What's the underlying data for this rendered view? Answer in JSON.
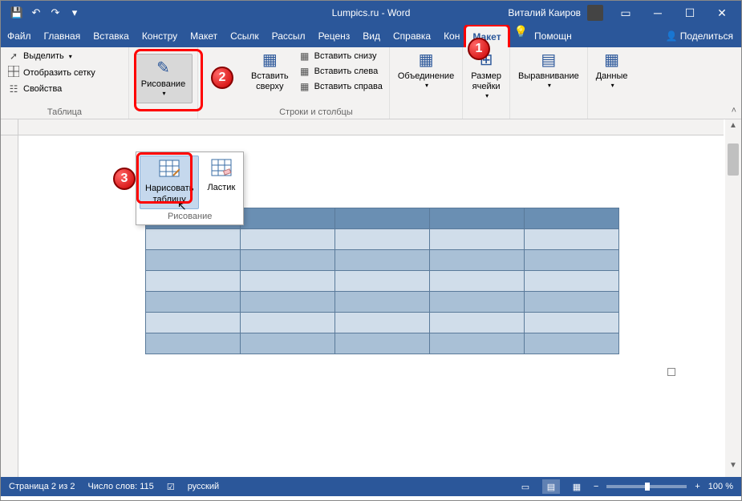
{
  "title": "Lumpics.ru - Word",
  "user": "Виталий Каиров",
  "tabs": [
    "Файл",
    "Главная",
    "Вставка",
    "Констру",
    "Макет",
    "Ссылк",
    "Рассыл",
    "Реценз",
    "Вид",
    "Справка",
    "Кон",
    "Макет"
  ],
  "tell_me": "Помощн",
  "share": "Поделиться",
  "ribbon": {
    "table_group": {
      "select": "Выделить",
      "show_grid": "Отобразить сетку",
      "properties": "Свойства",
      "label": "Таблица"
    },
    "draw_group": {
      "draw": "Рисование"
    },
    "rows_cols_group": {
      "insert_above": "Вставить\nсверху",
      "insert_below": "Вставить снизу",
      "insert_left": "Вставить слева",
      "insert_right": "Вставить справа",
      "label": "Строки и столбцы"
    },
    "merge": "Объединение",
    "cell_size": "Размер\nячейки",
    "align": "Выравнивание",
    "data": "Данные"
  },
  "dropdown": {
    "draw_table": "Нарисовать\nтаблицу",
    "eraser": "Ластик",
    "label": "Рисование"
  },
  "badges": {
    "one": "1",
    "two": "2",
    "three": "3"
  },
  "status": {
    "page": "Страница 2 из 2",
    "words": "Число слов: 115",
    "lang": "русский",
    "zoom": "100 %"
  }
}
